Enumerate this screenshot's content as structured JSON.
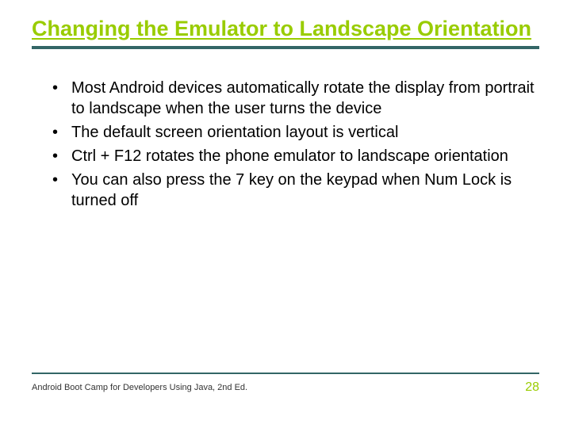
{
  "title": "Changing the Emulator to Landscape Orientation",
  "bullets": [
    "Most Android devices automatically rotate the display from portrait to landscape when the user turns the device",
    "The default screen orientation layout is vertical",
    "Ctrl + F12 rotates the phone emulator to landscape orientation",
    "You can also press the 7 key on the keypad when Num Lock is turned off"
  ],
  "footer": {
    "text": "Android Boot Camp for Developers Using Java, 2nd Ed.",
    "page": "28"
  }
}
